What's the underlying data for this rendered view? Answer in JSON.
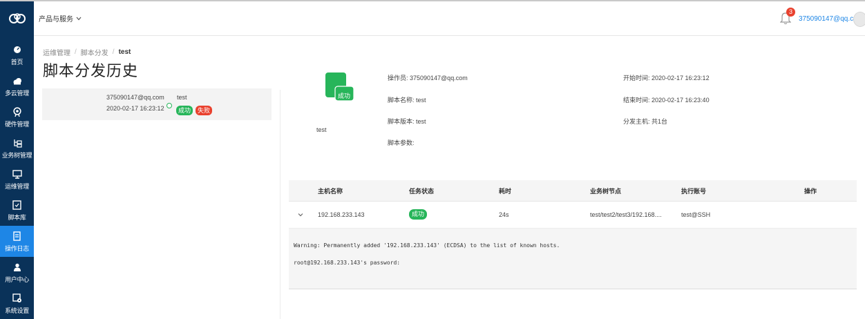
{
  "topbar": {
    "products_menu": "产品与服务",
    "notification_count": "3",
    "user_email": "375090147@qq.com"
  },
  "sidebar": {
    "items": [
      {
        "label": "首页",
        "icon": "dashboard-icon"
      },
      {
        "label": "多云管理",
        "icon": "cloud-icon"
      },
      {
        "label": "硬件管理",
        "icon": "hardware-icon"
      },
      {
        "label": "业务树管理",
        "icon": "tree-icon"
      },
      {
        "label": "运维管理",
        "icon": "monitor-icon"
      },
      {
        "label": "脚本库",
        "icon": "script-icon"
      },
      {
        "label": "操作日志",
        "icon": "log-icon",
        "active": true
      },
      {
        "label": "用户中心",
        "icon": "user-icon"
      },
      {
        "label": "系统设置",
        "icon": "settings-icon"
      }
    ]
  },
  "breadcrumb": [
    "运维管理",
    "脚本分发",
    "test"
  ],
  "page_title": "脚本分发历史",
  "history": {
    "items": [
      {
        "operator": "375090147@qq.com",
        "time": "2020-02-17 16:23:12",
        "name": "test",
        "tags": [
          "成功",
          "失败"
        ]
      }
    ]
  },
  "detail": {
    "status": "成功",
    "name": "test",
    "operator": "操作员: 375090147@qq.com",
    "script_name": "脚本名称: test",
    "script_version": "脚本版本: test",
    "script_params": "脚本参数:",
    "start_time": "开始时间: 2020-02-17 16:23:12",
    "end_time": "结束时间: 2020-02-17 16:23:40",
    "hosts": "分发主机: 共1台"
  },
  "table": {
    "columns": [
      "主机名称",
      "任务状态",
      "耗时",
      "业务树节点",
      "执行账号",
      "操作"
    ],
    "rows": [
      {
        "host": "192.168.233.143",
        "status": "成功",
        "duration": "24s",
        "node": "test/test2/test3/192.168....",
        "account": "test@SSH"
      }
    ],
    "log": [
      "Warning: Permanently added '192.168.233.143' (ECDSA) to the list of known hosts.",
      "root@192.168.233.143's password:"
    ]
  },
  "colors": {
    "sidebar_bg": "#0a3259",
    "active_nav": "#1e86e6",
    "success": "#27b55a",
    "fail": "#e9412e",
    "link": "#1e86e6"
  }
}
